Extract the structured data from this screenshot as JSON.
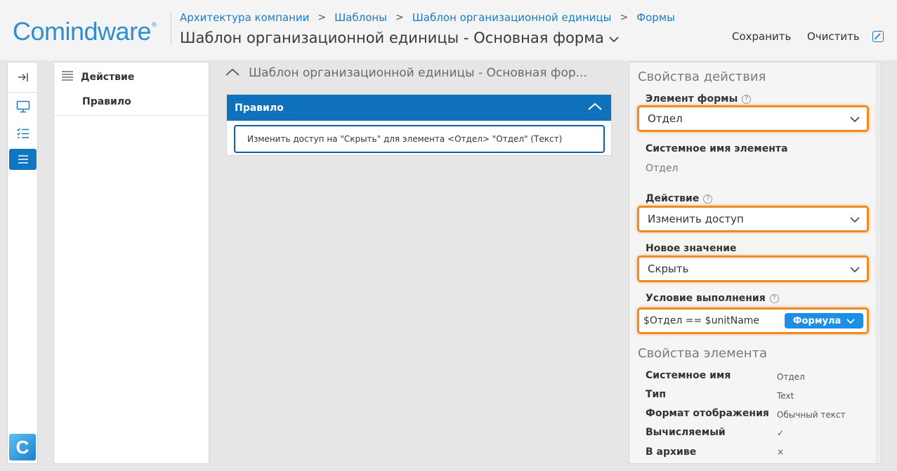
{
  "header": {
    "logo_text": "Comindware",
    "logo_mark": "®",
    "breadcrumb": [
      "Архитектура компании",
      "Шаблоны",
      "Шаблон организационной единицы",
      "Формы"
    ],
    "title": "Шаблон организационной единицы - Основная форма",
    "save_label": "Сохранить",
    "clear_label": "Очистить"
  },
  "rail": {
    "logo_letter": "C"
  },
  "tree": {
    "header_label": "Действие",
    "item_label": "Правило"
  },
  "center": {
    "title": "Шаблон организационной единицы - Основная фор...",
    "rule_title": "Правило",
    "rule_text": "Изменить доступ на \"Скрыть\" для элемента <Отдел> \"Отдел\" (Текст)"
  },
  "props": {
    "action_section": "Свойства действия",
    "form_element_label": "Элемент формы",
    "form_element_value": "Отдел",
    "system_name_label": "Системное имя элемента",
    "system_name_value": "Отдел",
    "action_label": "Действие",
    "action_value": "Изменить доступ",
    "new_value_label": "Новое значение",
    "new_value_value": "Скрыть",
    "condition_label": "Условие выполнения",
    "condition_value": "$Отдел == $unitName",
    "formula_label": "Формула",
    "help_glyph": "?",
    "element_section": "Свойства элемента",
    "element_props": [
      {
        "key": "Системное имя",
        "value": "Отдел"
      },
      {
        "key": "Тип",
        "value": "Text"
      },
      {
        "key": "Формат отображения",
        "value": "Обычный текст"
      },
      {
        "key": "Вычисляемый",
        "value": "✓"
      },
      {
        "key": "В архиве",
        "value": "×"
      }
    ]
  },
  "colors": {
    "brand_blue": "#1176c2",
    "highlight_orange": "#f08a24",
    "link_blue": "#1e7ac2"
  }
}
